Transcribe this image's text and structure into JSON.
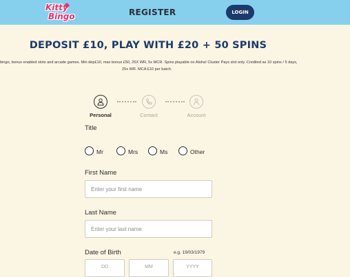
{
  "header": {
    "logo_line1": "Kitty",
    "logo_line2": "Bingo",
    "title": "REGISTER",
    "login_label": "LOGIN"
  },
  "promo": {
    "headline": "DEPOSIT £10, PLAY WITH £20 + 50 SPINS",
    "terms_line1": "bingo, bonus enabled slots and arcade games. Min dep£10, max bonus £50, 25X WR, 5x MCR. Spins playable on Aloha! Cluster Pays slot only. Credited as 10 spins / 5 days,",
    "terms_line2": "25x WR. MCA £10 per batch."
  },
  "stepper": {
    "steps": [
      {
        "label": "Personal",
        "icon": "person-icon",
        "active": true
      },
      {
        "label": "Contact",
        "icon": "phone-icon",
        "active": false
      },
      {
        "label": "Account",
        "icon": "account-icon",
        "active": false
      }
    ]
  },
  "form": {
    "title_label": "Title",
    "title_options": [
      "Mr",
      "Mrs",
      "Ms",
      "Other"
    ],
    "first_name_label": "First Name",
    "first_name_placeholder": "Enter your first name",
    "last_name_label": "Last Name",
    "last_name_placeholder": "Enter your last name",
    "dob_label": "Date of Birth",
    "dob_hint": "e.g. 19/03/1979",
    "dob_day": "DD",
    "dob_month": "MM",
    "dob_year": "YYYY"
  },
  "colors": {
    "header_bg": "#86d0ee",
    "page_bg": "#fbf5e4",
    "brand_navy": "#1c3a6b",
    "brand_pink": "#e4326f"
  }
}
